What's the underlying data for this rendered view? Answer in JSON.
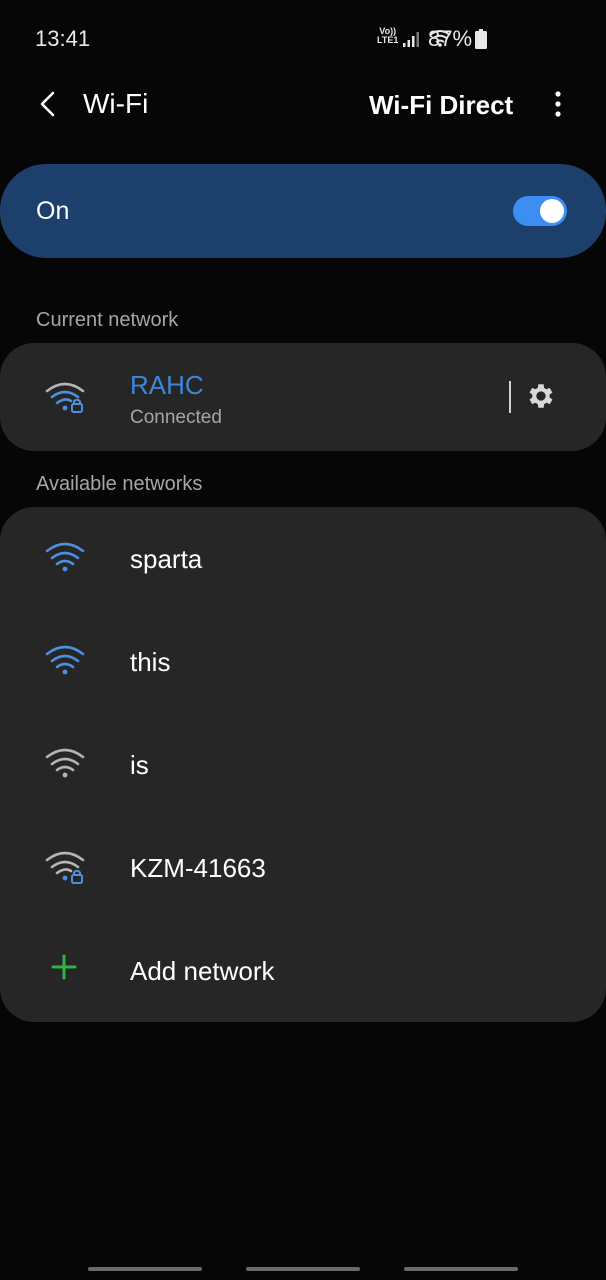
{
  "status_bar": {
    "time": "13:41",
    "network_type": "LTE1",
    "volte": "Vo))",
    "battery": "87%"
  },
  "app_bar": {
    "back_icon": "chevron-left-icon",
    "title": "Wi-Fi",
    "wifi_direct_label": "Wi-Fi Direct",
    "more_icon": "more-vertical-icon"
  },
  "master_switch": {
    "label": "On",
    "enabled": true
  },
  "current_section": {
    "header": "Current network",
    "network": {
      "name": "RAHC",
      "status": "Connected",
      "secured": true,
      "icon": "wifi-lock-icon",
      "settings_icon": "gear-icon"
    }
  },
  "available_section": {
    "header": "Available networks",
    "networks": [
      {
        "name": "sparta",
        "secured": false,
        "icon": "wifi-icon",
        "color": "#4d8fe0"
      },
      {
        "name": "this",
        "secured": false,
        "icon": "wifi-icon",
        "color": "#4d8fe0"
      },
      {
        "name": "is",
        "secured": false,
        "icon": "wifi-icon",
        "color": "#b5b5b5"
      },
      {
        "name": "KZM-41663",
        "secured": true,
        "icon": "wifi-lock-icon",
        "color": "#b5b5b5"
      }
    ],
    "add_network": {
      "label": "Add network",
      "icon": "plus-icon",
      "color": "#2fb34a"
    }
  },
  "colors": {
    "background": "#060606",
    "card": "#262626",
    "switch_bar": "#1c3f6b",
    "accent": "#3d86db",
    "toggle": "#3c8ef3"
  }
}
